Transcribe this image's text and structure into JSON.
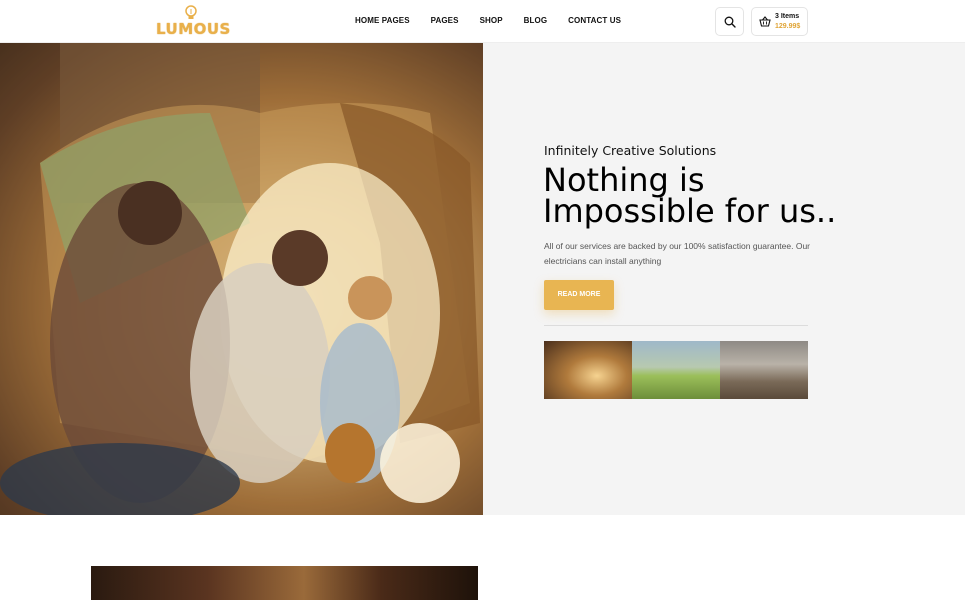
{
  "brand": {
    "name": "LUMOUS",
    "color": "#e9b04a"
  },
  "nav": {
    "items": [
      {
        "label": "HOME PAGES"
      },
      {
        "label": "PAGES"
      },
      {
        "label": "SHOP"
      },
      {
        "label": "BLOG"
      },
      {
        "label": "CONTACT US"
      }
    ]
  },
  "cart": {
    "count_label": "3 Items",
    "total": "129.99$"
  },
  "hero": {
    "subtitle": "Infinitely Creative Solutions",
    "headline_line1": "Nothing is",
    "headline_line2": "Impossible for us..",
    "description": "All of our services are backed by our 100% satisfaction guarantee. Our electricians can install anything",
    "cta_label": "READ MORE",
    "accent_color": "#e8b552"
  },
  "icons": {
    "search": "search-icon",
    "cart": "basket-icon",
    "logo": "lightbulb-icon"
  }
}
